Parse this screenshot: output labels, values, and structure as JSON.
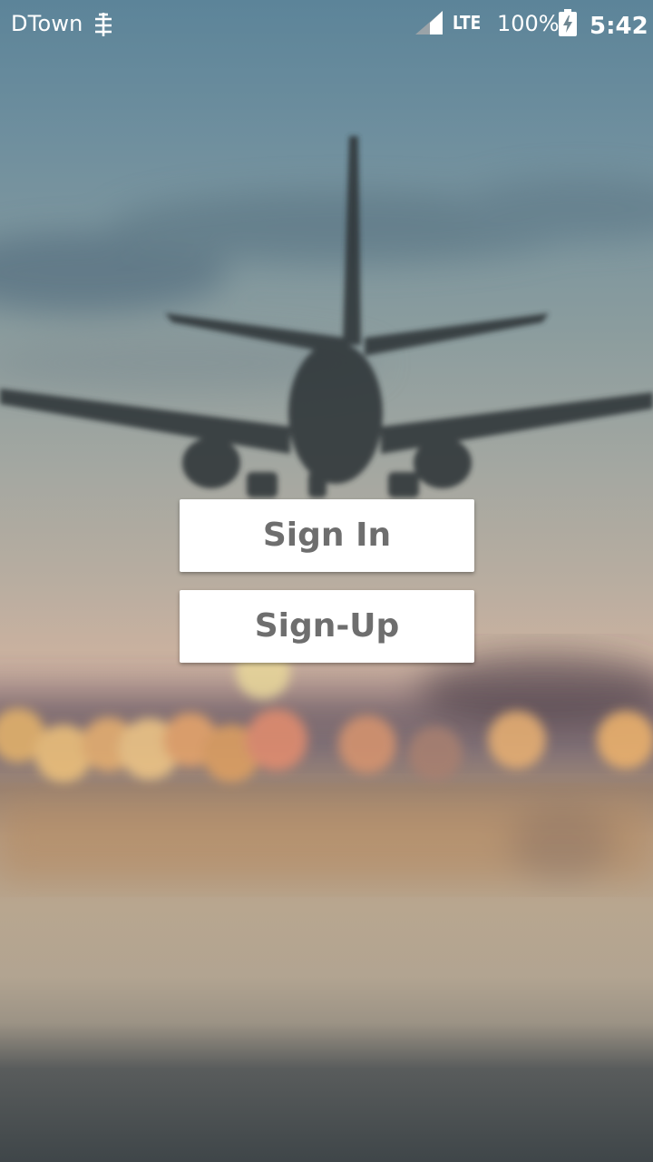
{
  "status_bar": {
    "carrier": "DTown",
    "carrier_icon": "hd-voice-icon",
    "signal_icon": "cell-signal-icon",
    "network_type": "LTE",
    "battery_percent": "100%",
    "battery_icon": "battery-charging-icon",
    "time": "5:42"
  },
  "background": {
    "image": "blurred-airplane-landing-photo"
  },
  "auth": {
    "sign_in_label": "Sign In",
    "sign_up_label": "Sign-Up"
  },
  "colors": {
    "button_background": "#ffffff",
    "button_text": "#6e6e6e",
    "status_text": "#ffffff"
  }
}
